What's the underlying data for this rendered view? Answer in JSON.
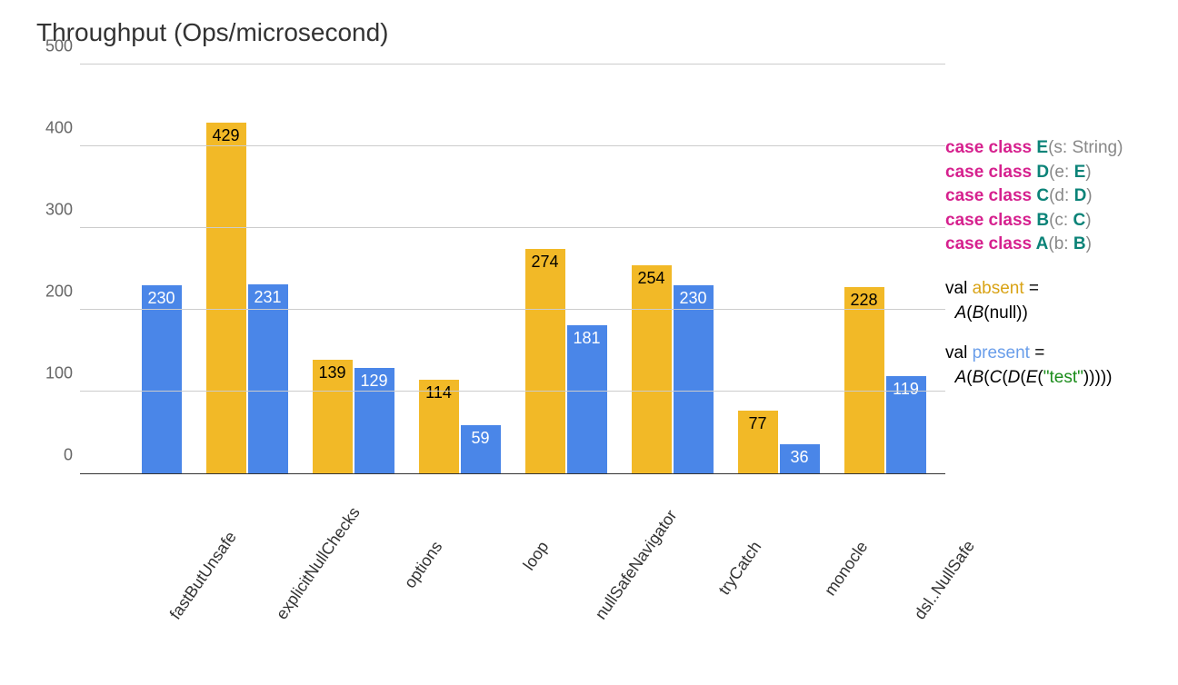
{
  "chart_data": {
    "type": "bar",
    "title": "Throughput (Ops/microsecond)",
    "xlabel": "",
    "ylabel": "",
    "ylim": [
      0,
      500
    ],
    "y_ticks": [
      0,
      100,
      200,
      300,
      400,
      500
    ],
    "categories": [
      "fastButUnsafe",
      "explicitNullChecks",
      "options",
      "loop",
      "nullSafeNavigator",
      "tryCatch",
      "monocle",
      "dsl..NullSafe"
    ],
    "series": [
      {
        "name": "absent",
        "color": "#f2b927",
        "values": [
          null,
          429,
          139,
          114,
          274,
          254,
          77,
          228
        ]
      },
      {
        "name": "present",
        "color": "#4a86e8",
        "values": [
          230,
          231,
          129,
          59,
          181,
          230,
          36,
          119
        ]
      }
    ]
  },
  "legend": {
    "classes": [
      {
        "kw": "case class ",
        "name": "E",
        "param": "(s: String)"
      },
      {
        "kw": "case class ",
        "name": "D",
        "param_open": "(e: ",
        "param_type": "E",
        "param_close": ")"
      },
      {
        "kw": "case class ",
        "name": "C",
        "param_open": "(d: ",
        "param_type": "D",
        "param_close": ")"
      },
      {
        "kw": "case class ",
        "name": "B",
        "param_open": "(c: ",
        "param_type": "C",
        "param_close": ")"
      },
      {
        "kw": "case class ",
        "name": "A",
        "param_open": "(b: ",
        "param_type": "B",
        "param_close": ")"
      }
    ],
    "absent": {
      "decl": "val ",
      "name": "absent",
      "eq": " =",
      "expr_pre": "A",
      "expr_mid": "(",
      "expr_b": "B",
      "expr_rest": "(null))"
    },
    "present": {
      "decl": "val ",
      "name": "present",
      "eq": " =",
      "expr_pre": "A",
      "expr_p1": "(",
      "expr_b": "B",
      "expr_p2": "(",
      "expr_c": "C",
      "expr_p3": "(",
      "expr_d": "D",
      "expr_p4": "(",
      "expr_e": "E",
      "expr_p5": "(",
      "expr_str": "\"test\"",
      "expr_close": ")))))"
    }
  }
}
